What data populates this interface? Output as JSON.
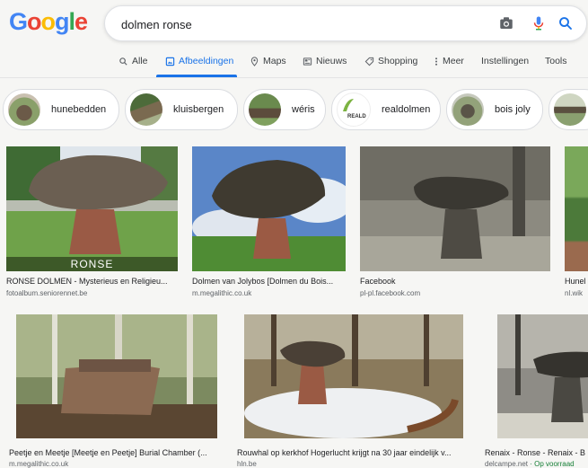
{
  "header": {
    "logo": [
      "G",
      "o",
      "o",
      "g",
      "l",
      "e"
    ],
    "query": "dolmen ronse"
  },
  "tabs": [
    {
      "label": "Alle",
      "icon": "search-icon",
      "active": false
    },
    {
      "label": "Afbeeldingen",
      "icon": "image-icon",
      "active": true
    },
    {
      "label": "Maps",
      "icon": "map-pin-icon",
      "active": false
    },
    {
      "label": "Nieuws",
      "icon": "news-icon",
      "active": false
    },
    {
      "label": "Shopping",
      "icon": "tag-icon",
      "active": false
    },
    {
      "label": "Meer",
      "icon": "more-vert-icon",
      "active": false
    },
    {
      "label": "Instellingen",
      "active": false
    },
    {
      "label": "Tools",
      "active": false
    }
  ],
  "chips": [
    "hunebedden",
    "kluisbergen",
    "wéris",
    "realdolmen",
    "bois joly"
  ],
  "chip_overlay_text": "REALD",
  "results": [
    {
      "title": "RONSE DOLMEN - Mysterieus en Religieu...",
      "source": "fotoalbum.seniorennet.be",
      "overlay": "RONSE"
    },
    {
      "title": "Dolmen van Jolybos [Dolmen du Bois...",
      "source": "m.megalithic.co.uk"
    },
    {
      "title": "Facebook",
      "source": "pl-pl.facebook.com"
    },
    {
      "title": "Hunel",
      "source": "nl.wik"
    },
    {
      "title": "Peetje en Meetje [Meetje en Peetje] Burial Chamber (...",
      "source": "m.megalithic.co.uk"
    },
    {
      "title": "Rouwhal op kerkhof Hogerlucht krijgt na 30 jaar eindelijk v...",
      "source": "hln.be"
    },
    {
      "title": "Renaix - Ronse - Renaix - B",
      "source": "delcampe.net",
      "source_extra": " · Op voorraad"
    }
  ],
  "colors": {
    "blue": "#4285f4",
    "red": "#ea4335",
    "yellow": "#fbbc05",
    "green": "#34a853",
    "accent": "#1a73e8"
  }
}
